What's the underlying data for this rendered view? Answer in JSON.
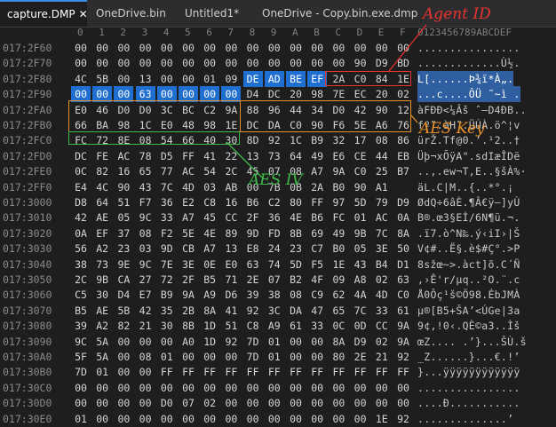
{
  "tabs": [
    {
      "label": "capture.DMP",
      "active": true,
      "close": "✕"
    },
    {
      "label": "OneDrive.bin",
      "active": false
    },
    {
      "label": "Untitled1*",
      "active": false
    },
    {
      "label": "OneDrive - Copy.bin.exe.dmp",
      "active": false
    }
  ],
  "header": {
    "columns": [
      "0",
      "1",
      "2",
      "3",
      "4",
      "5",
      "6",
      "7",
      "8",
      "9",
      "A",
      "B",
      "C",
      "D",
      "E",
      "F"
    ],
    "ascii_header": "0123456789ABCDEF"
  },
  "rows": [
    {
      "offset": "017:2F60",
      "bytes": [
        "00",
        "00",
        "00",
        "00",
        "00",
        "00",
        "00",
        "00",
        "00",
        "00",
        "00",
        "00",
        "00",
        "00",
        "00",
        "00"
      ],
      "ascii": "................"
    },
    {
      "offset": "017:2F70",
      "bytes": [
        "00",
        "00",
        "00",
        "00",
        "00",
        "00",
        "00",
        "00",
        "00",
        "00",
        "00",
        "00",
        "00",
        "90",
        "D9",
        "BD",
        "8F"
      ],
      "ascii": ".............Ù½."
    },
    {
      "offset": "017:2F80",
      "bytes": [
        "4C",
        "5B",
        "00",
        "13",
        "00",
        "00",
        "01",
        "09",
        "DE",
        "AD",
        "BE",
        "EF",
        "2A",
        "C0",
        "84",
        "1E"
      ],
      "ascii": "L[......Þ­¾ï*À„."
    },
    {
      "offset": "017:2F90",
      "bytes": [
        "00",
        "00",
        "00",
        "63",
        "00",
        "00",
        "00",
        "00",
        "D4",
        "DC",
        "20",
        "98",
        "7E",
        "EC",
        "20",
        "02"
      ],
      "ascii": "...c....ÔÜ ˜~ì ."
    },
    {
      "offset": "017:2FA0",
      "bytes": [
        "E0",
        "46",
        "D0",
        "D0",
        "3C",
        "BC",
        "C2",
        "9A",
        "88",
        "96",
        "44",
        "34",
        "D0",
        "42",
        "90",
        "12"
      ],
      "ascii": "àFÐÐ<¼Âš ˆ–D4ÐB.."
    },
    {
      "offset": "017:2FB0",
      "bytes": [
        "66",
        "BA",
        "98",
        "1C",
        "E0",
        "48",
        "98",
        "1E",
        "DC",
        "DA",
        "C0",
        "90",
        "F6",
        "5E",
        "A6",
        "76"
      ],
      "ascii": "fº˜.àH˜.ÜÚÀ.ö^¦v"
    },
    {
      "offset": "017:2FC0",
      "bytes": [
        "FC",
        "72",
        "8E",
        "08",
        "54",
        "66",
        "40",
        "30",
        "8D",
        "92",
        "1C",
        "B9",
        "32",
        "17",
        "08",
        "86"
      ],
      "ascii": "ürŽ.Tf@0.’.¹2..†"
    },
    {
      "offset": "017:2FD0",
      "bytes": [
        "DC",
        "FE",
        "AC",
        "78",
        "D5",
        "FF",
        "41",
        "22",
        "13",
        "73",
        "64",
        "49",
        "E6",
        "CE",
        "44",
        "EB"
      ],
      "ascii": "Üþ¬xÕÿA\".sdIæÎDë"
    },
    {
      "offset": "017:2FE0",
      "bytes": [
        "0C",
        "82",
        "16",
        "65",
        "77",
        "AC",
        "54",
        "2C",
        "45",
        "07",
        "08",
        "A7",
        "9A",
        "C0",
        "25",
        "B7"
      ],
      "ascii": "..‚.ew¬T,E..§šÀ%·"
    },
    {
      "offset": "017:2FF0",
      "bytes": [
        "E4",
        "4C",
        "90",
        "43",
        "7C",
        "4D",
        "03",
        "AB",
        "00",
        "7B",
        "0B",
        "2A",
        "B0",
        "90",
        "A1"
      ],
      "ascii": "äL.C|M..{..*°.¡"
    },
    {
      "offset": "017:3000",
      "bytes": [
        "D8",
        "64",
        "51",
        "F7",
        "36",
        "E2",
        "C8",
        "16",
        "B6",
        "C2",
        "80",
        "FF",
        "97",
        "5D",
        "79",
        "D9"
      ],
      "ascii": "ØdQ÷6âÈ.¶Â€ÿ—]yÙ"
    },
    {
      "offset": "017:3010",
      "bytes": [
        "42",
        "AE",
        "05",
        "9C",
        "33",
        "A7",
        "45",
        "CC",
        "2F",
        "36",
        "4E",
        "B6",
        "FC",
        "01",
        "AC",
        "0A"
      ],
      "ascii": "B®.œ3§EÌ/6N¶ü.¬."
    },
    {
      "offset": "017:3020",
      "bytes": [
        "0A",
        "EF",
        "37",
        "08",
        "F2",
        "5E",
        "4E",
        "89",
        "9D",
        "FD",
        "8B",
        "69",
        "49",
        "9B",
        "7C",
        "8A"
      ],
      "ascii": ".ï7.ò^N‰.ý‹iI›|Š"
    },
    {
      "offset": "017:3030",
      "bytes": [
        "56",
        "A2",
        "23",
        "03",
        "9D",
        "CB",
        "A7",
        "13",
        "E8",
        "24",
        "23",
        "C7",
        "B0",
        "05",
        "3E",
        "50"
      ],
      "ascii": "V¢#..Ë§.è$#Ç°.>P"
    },
    {
      "offset": "017:3040",
      "bytes": [
        "38",
        "73",
        "9E",
        "9C",
        "7E",
        "3E",
        "0E",
        "E0",
        "63",
        "74",
        "5D",
        "F5",
        "1E",
        "43",
        "B4",
        "D1"
      ],
      "ascii": "8sžœ~>.àct]õ.C´Ñ"
    },
    {
      "offset": "017:3050",
      "bytes": [
        "2C",
        "9B",
        "CA",
        "27",
        "72",
        "2F",
        "B5",
        "71",
        "2E",
        "07",
        "B2",
        "4F",
        "09",
        "A8",
        "02",
        "63"
      ],
      "ascii": ",›Ê'r/µq..²O.¨.c"
    },
    {
      "offset": "017:3060",
      "bytes": [
        "C5",
        "30",
        "D4",
        "E7",
        "B9",
        "9A",
        "A9",
        "D6",
        "39",
        "38",
        "08",
        "C9",
        "62",
        "4A",
        "4D",
        "C0"
      ],
      "ascii": "Å0Ôç¹š©Ö98.ÉbJMÀ"
    },
    {
      "offset": "017:3070",
      "bytes": [
        "B5",
        "AE",
        "5B",
        "42",
        "35",
        "2B",
        "8A",
        "41",
        "92",
        "3C",
        "DA",
        "47",
        "65",
        "7C",
        "33",
        "61"
      ],
      "ascii": "µ®[B5+ŠA’<ÚGe|3a"
    },
    {
      "offset": "017:3080",
      "bytes": [
        "39",
        "A2",
        "82",
        "21",
        "30",
        "8B",
        "1D",
        "51",
        "C8",
        "A9",
        "61",
        "33",
        "0C",
        "0D",
        "CC",
        "9A"
      ],
      "ascii": "9¢‚!0‹.QÈ©a3..Ìš"
    },
    {
      "offset": "017:3090",
      "bytes": [
        "9C",
        "5A",
        "00",
        "00",
        "00",
        "A0",
        "1D",
        "92",
        "7D",
        "01",
        "00",
        "00",
        "8A",
        "D9",
        "02",
        "9A"
      ],
      "ascii": "œZ.... .’}...ŠÙ.š"
    },
    {
      "offset": "017:30A0",
      "bytes": [
        "5F",
        "5A",
        "00",
        "08",
        "01",
        "00",
        "00",
        "00",
        "7D",
        "01",
        "00",
        "00",
        "80",
        "2E",
        "21",
        "92"
      ],
      "ascii": "_Z......}...€.!’"
    },
    {
      "offset": "017:30B0",
      "bytes": [
        "7D",
        "01",
        "00",
        "00",
        "FF",
        "FF",
        "FF",
        "FF",
        "FF",
        "FF",
        "FF",
        "FF",
        "FF",
        "FF",
        "FF",
        "FF"
      ],
      "ascii": "}...ÿÿÿÿÿÿÿÿÿÿÿÿ"
    },
    {
      "offset": "017:30C0",
      "bytes": [
        "00",
        "00",
        "00",
        "00",
        "00",
        "00",
        "00",
        "00",
        "00",
        "00",
        "00",
        "00",
        "00",
        "00",
        "00",
        "00"
      ],
      "ascii": "................"
    },
    {
      "offset": "017:30D0",
      "bytes": [
        "00",
        "00",
        "00",
        "00",
        "D0",
        "07",
        "02",
        "00",
        "00",
        "00",
        "00",
        "00",
        "00",
        "00",
        "00",
        "00"
      ],
      "ascii": "....Ð..........."
    },
    {
      "offset": "017:30E0",
      "bytes": [
        "01",
        "00",
        "00",
        "00",
        "00",
        "00",
        "00",
        "00",
        "00",
        "00",
        "00",
        "00",
        "00",
        "00",
        "1E",
        "92"
      ],
      "ascii": "..............’"
    }
  ],
  "annotations": {
    "agent_id": {
      "label": "Agent ID",
      "color": "#e8332f"
    },
    "aes_key": {
      "label": "AES Key",
      "color": "#e8902c"
    },
    "aes_iv": {
      "label": "AES IV",
      "color": "#3fb94a"
    }
  },
  "colors": {
    "selection": "#1f6fd1",
    "background": "#1e1e1e"
  }
}
